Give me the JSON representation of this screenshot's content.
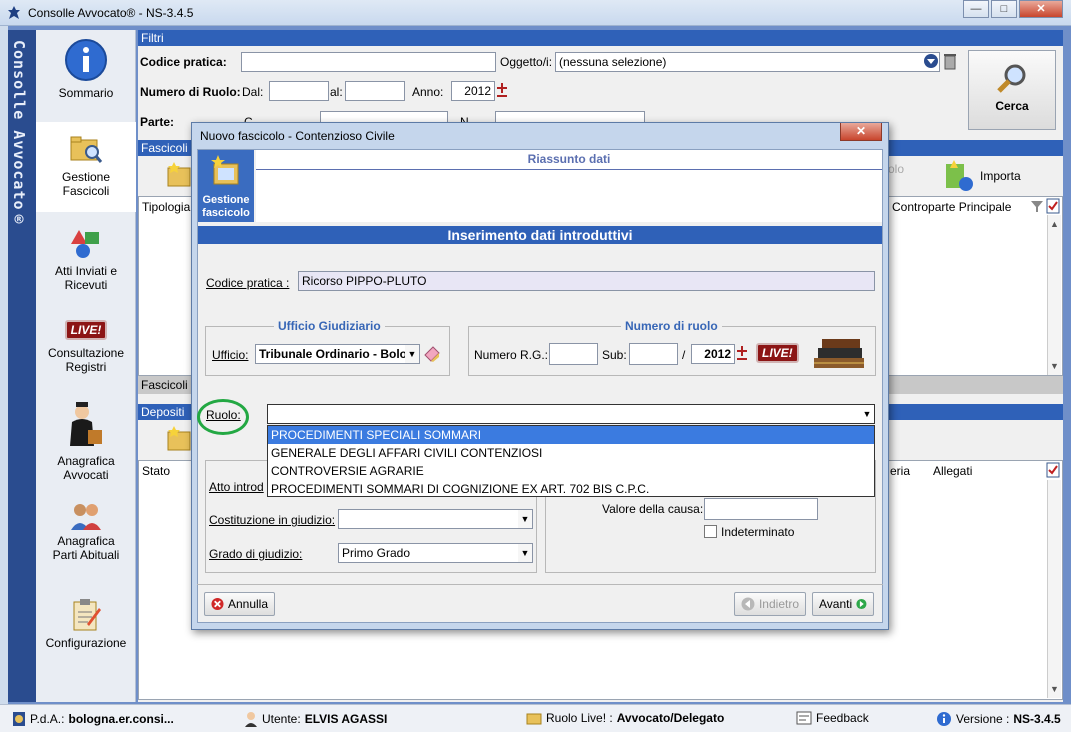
{
  "window": {
    "title": "Consolle Avvocato® - NS-3.4.5",
    "min": "—",
    "max": "□",
    "close": "✕"
  },
  "side_strip_text": "Consolle Avvocato®",
  "sidebar": {
    "items": [
      {
        "label": "Sommario"
      },
      {
        "label": "Gestione Fascicoli"
      },
      {
        "label": "Atti Inviati e Ricevuti"
      },
      {
        "label": "Consultazione Registri",
        "badge": "LIVE!"
      },
      {
        "label": "Anagrafica Avvocati"
      },
      {
        "label": "Anagrafica Parti Abituali"
      },
      {
        "label": "Configurazione"
      }
    ]
  },
  "filtri": {
    "header": "Filtri",
    "codice_label": "Codice pratica:",
    "oggetto_label": "Oggetto/i:",
    "oggetto_value": "(nessuna selezione)",
    "numero_ruolo_label": "Numero di Ruolo:",
    "dal_label": "Dal:",
    "al_label": "al:",
    "anno_label": "Anno:",
    "anno_value": "2012",
    "parte_label": "Parte:",
    "c_label": "C",
    "n_label": "N",
    "cerca": "Cerca"
  },
  "fascicoli": {
    "header": "Fascicoli",
    "col_tipologia": "Tipologia",
    "col_controparte": "Controparte Principale",
    "importa": "Importa",
    "partial_label": "olo",
    "footer_label": "Fascicoli"
  },
  "depositi": {
    "header": "Depositi",
    "col_stato": "Stato",
    "col_eria": "eria",
    "col_allegati": "Allegati"
  },
  "statusbar": {
    "pda_label": "P.d.A.:",
    "pda_value": "bologna.er.consi...",
    "utente_label": "Utente:",
    "utente_value": "ELVIS AGASSI",
    "ruolo_label": "Ruolo Live! :",
    "ruolo_value": "Avvocato/Delegato",
    "feedback": "Feedback",
    "versione_label": "Versione :",
    "versione_value": "NS-3.4.5"
  },
  "dialog": {
    "title": "Nuovo fascicolo - Contenzioso Civile",
    "close": "✕",
    "tile_label_1": "Gestione",
    "tile_label_2": "fascicolo",
    "riassunto": "Riassunto dati",
    "band": "Inserimento dati introduttivi",
    "codice_label": "Codice pratica :",
    "codice_value": "Ricorso PIPPO-PLUTO",
    "ufficio_group": "Ufficio Giudiziario",
    "ufficio_label": "Ufficio:",
    "ufficio_value": "Tribunale Ordinario - Bolo...",
    "numero_group": "Numero di ruolo",
    "rg_label": "Numero R.G.:",
    "sub_label": "Sub:",
    "slash": "/",
    "anno_value": "2012",
    "live_badge": "LIVE!",
    "ruolo_label": "Ruolo:",
    "ruolo_value": "",
    "ruolo_options": [
      "PROCEDIMENTI SPECIALI SOMMARI",
      "GENERALE DEGLI AFFARI CIVILI CONTENZIOSI",
      "CONTROVERSIE AGRARIE",
      "PROCEDIMENTI SOMMARI DI COGNIZIONE EX ART. 702 BIS C.P.C."
    ],
    "atto_label": "Atto introd",
    "costituzione_label": "Costituzione in giudizio:",
    "costituzione_value": "",
    "grado_label": "Grado di giudizio:",
    "grado_value": "Primo Grado",
    "valore_label": "Valore della causa:",
    "valore_value": "",
    "indeterminato_label": "Indeterminato",
    "annulla": "Annulla",
    "indietro": "Indietro",
    "avanti": "Avanti"
  },
  "colors": {
    "accent": "#2f61b8",
    "sidebar_strip": "#2a4c8f",
    "highlight": "#3b7be0",
    "ring": "#23a843"
  }
}
